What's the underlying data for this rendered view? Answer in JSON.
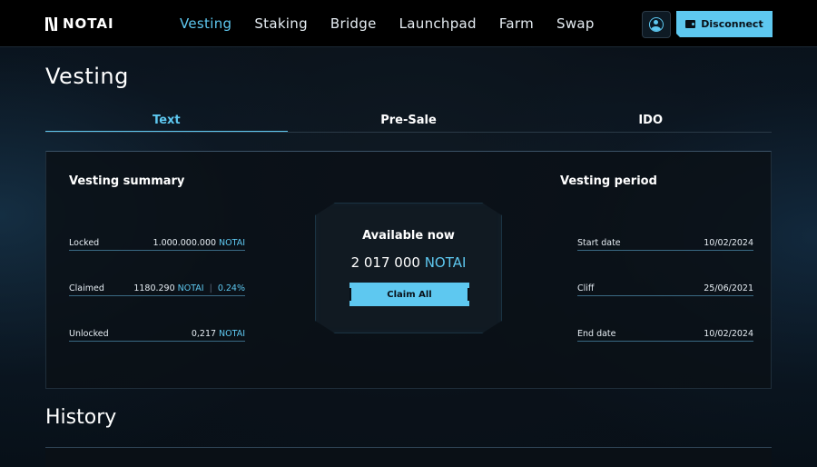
{
  "brand": {
    "name": "NOTAI"
  },
  "nav": {
    "items": [
      {
        "label": "Vesting",
        "active": true
      },
      {
        "label": "Staking",
        "active": false
      },
      {
        "label": "Bridge",
        "active": false
      },
      {
        "label": "Launchpad",
        "active": false
      },
      {
        "label": "Farm",
        "active": false
      },
      {
        "label": "Swap",
        "active": false
      }
    ]
  },
  "header": {
    "disconnect_label": "Disconnect",
    "avatar_icon": "user-avatar-icon",
    "wallet_icon": "wallet-icon"
  },
  "page": {
    "title": "Vesting"
  },
  "tabs": [
    {
      "label": "Text",
      "active": true
    },
    {
      "label": "Pre-Sale",
      "active": false
    },
    {
      "label": "IDO",
      "active": false
    }
  ],
  "summary": {
    "title": "Vesting summary",
    "locked": {
      "label": "Locked",
      "amount": "1.000.000.000",
      "unit": "NOTAI"
    },
    "claimed": {
      "label": "Claimed",
      "amount": "1180.290",
      "unit": "NOTAI",
      "percent": "0.24%"
    },
    "unlocked": {
      "label": "Unlocked",
      "amount": "0,217",
      "unit": "NOTAI"
    }
  },
  "available": {
    "title": "Available now",
    "amount": "2 017 000",
    "unit": "NOTAI",
    "claim_label": "Claim All"
  },
  "period": {
    "title": "Vesting period",
    "start": {
      "label": "Start date",
      "value": "10/02/2024"
    },
    "cliff": {
      "label": "Cliff",
      "value": "25/06/2021"
    },
    "end": {
      "label": "End date",
      "value": "10/02/2024"
    }
  },
  "history": {
    "title": "History"
  },
  "colors": {
    "accent": "#5ec8f0",
    "background": "#0a1119",
    "topbar": "#000000"
  }
}
